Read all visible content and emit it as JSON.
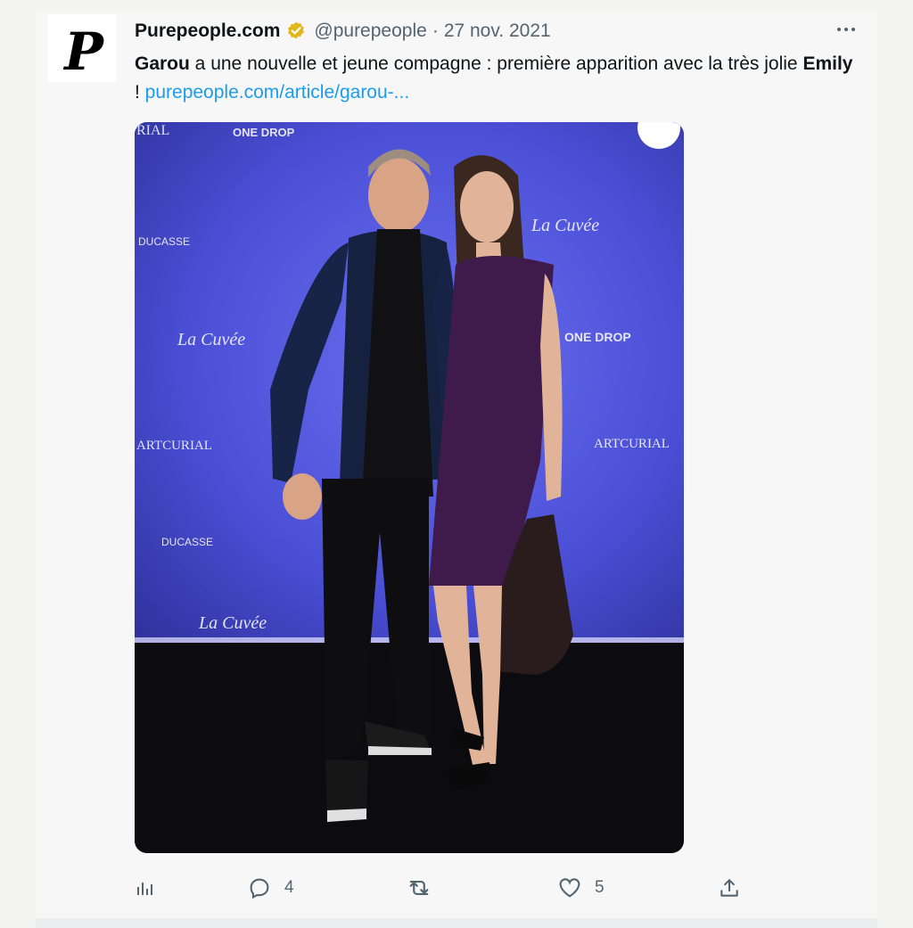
{
  "tweet": {
    "author": {
      "avatar_letter": "P",
      "display_name": "Purepeople.com",
      "verified_icon": "verified-badge-icon",
      "handle": "@purepeople",
      "separator": "·",
      "date": "27 nov. 2021"
    },
    "text": {
      "part1_bold": "Garou",
      "part2": " a une nouvelle et jeune compagne : première apparition avec la très jolie ",
      "part3_bold": "Emily",
      "part4": " ! ",
      "link": "purepeople.com/article/garou-..."
    },
    "media": {
      "backdrop_logos": [
        "RIAL",
        "ONE DROP",
        "La Cuvée",
        "ARTCURIAL",
        "DUCASSE",
        "ONE DROP",
        "La Cuvée",
        "ARTCURIAL",
        "DUCASSE",
        "La Cuvée"
      ]
    },
    "actions": {
      "views_icon": "analytics-icon",
      "reply_icon": "reply-icon",
      "reply_count": "4",
      "retweet_icon": "retweet-icon",
      "like_icon": "heart-icon",
      "like_count": "5",
      "share_icon": "share-icon"
    }
  },
  "colors": {
    "link": "#1d9bf0",
    "secondary_text": "#536471",
    "verified_gold": "#e2b719",
    "backdrop_blue": "#4a4fd6",
    "dress_purple": "#3e1b4a"
  }
}
